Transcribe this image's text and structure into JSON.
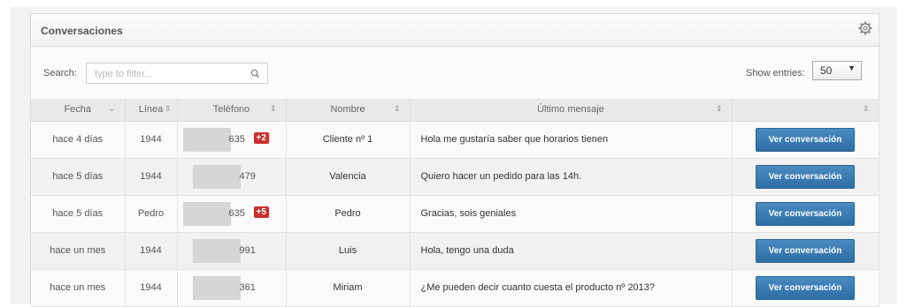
{
  "panel": {
    "title": "Conversaciones",
    "settings_icon": "gear-icon"
  },
  "search": {
    "label": "Search:",
    "placeholder": "type to filter...",
    "icon": "search-icon"
  },
  "entries": {
    "label": "Show entries:",
    "value": "50"
  },
  "table": {
    "headers": [
      "Fecha",
      "Línea",
      "Teléfono",
      "Nombre",
      "Último mensaje",
      ""
    ],
    "rows": [
      {
        "fecha": "hace 4 días",
        "linea": "1944",
        "telefono": "635",
        "badge": "+2",
        "nombre": "Cliente nº 1",
        "mensaje": "Hola me gustaría saber que horarios tienen",
        "action": "Ver conversación"
      },
      {
        "fecha": "hace 5 días",
        "linea": "1944",
        "telefono": "479",
        "badge": "",
        "nombre": "Valencia",
        "mensaje": "Quiero hacer un pedido para las 14h.",
        "action": "Ver conversación"
      },
      {
        "fecha": "hace 5 días",
        "linea": "Pedro",
        "telefono": "635",
        "badge": "+5",
        "nombre": "Pedro",
        "mensaje": "Gracias, sois geniales",
        "action": "Ver conversación"
      },
      {
        "fecha": "hace un mes",
        "linea": "1944",
        "telefono": "991",
        "badge": "",
        "nombre": "Luis",
        "mensaje": "Hola, tengo una duda",
        "action": "Ver conversación"
      },
      {
        "fecha": "hace un mes",
        "linea": "1944",
        "telefono": "361",
        "badge": "",
        "nombre": "Miriam",
        "mensaje": "¿Me pueden decir cuanto cuesta el producto nº 2013?",
        "action": "Ver conversación"
      }
    ]
  },
  "colors": {
    "button": "#3a7bb4",
    "badge": "#c9302c",
    "header_bg": "#e9e9e9"
  }
}
